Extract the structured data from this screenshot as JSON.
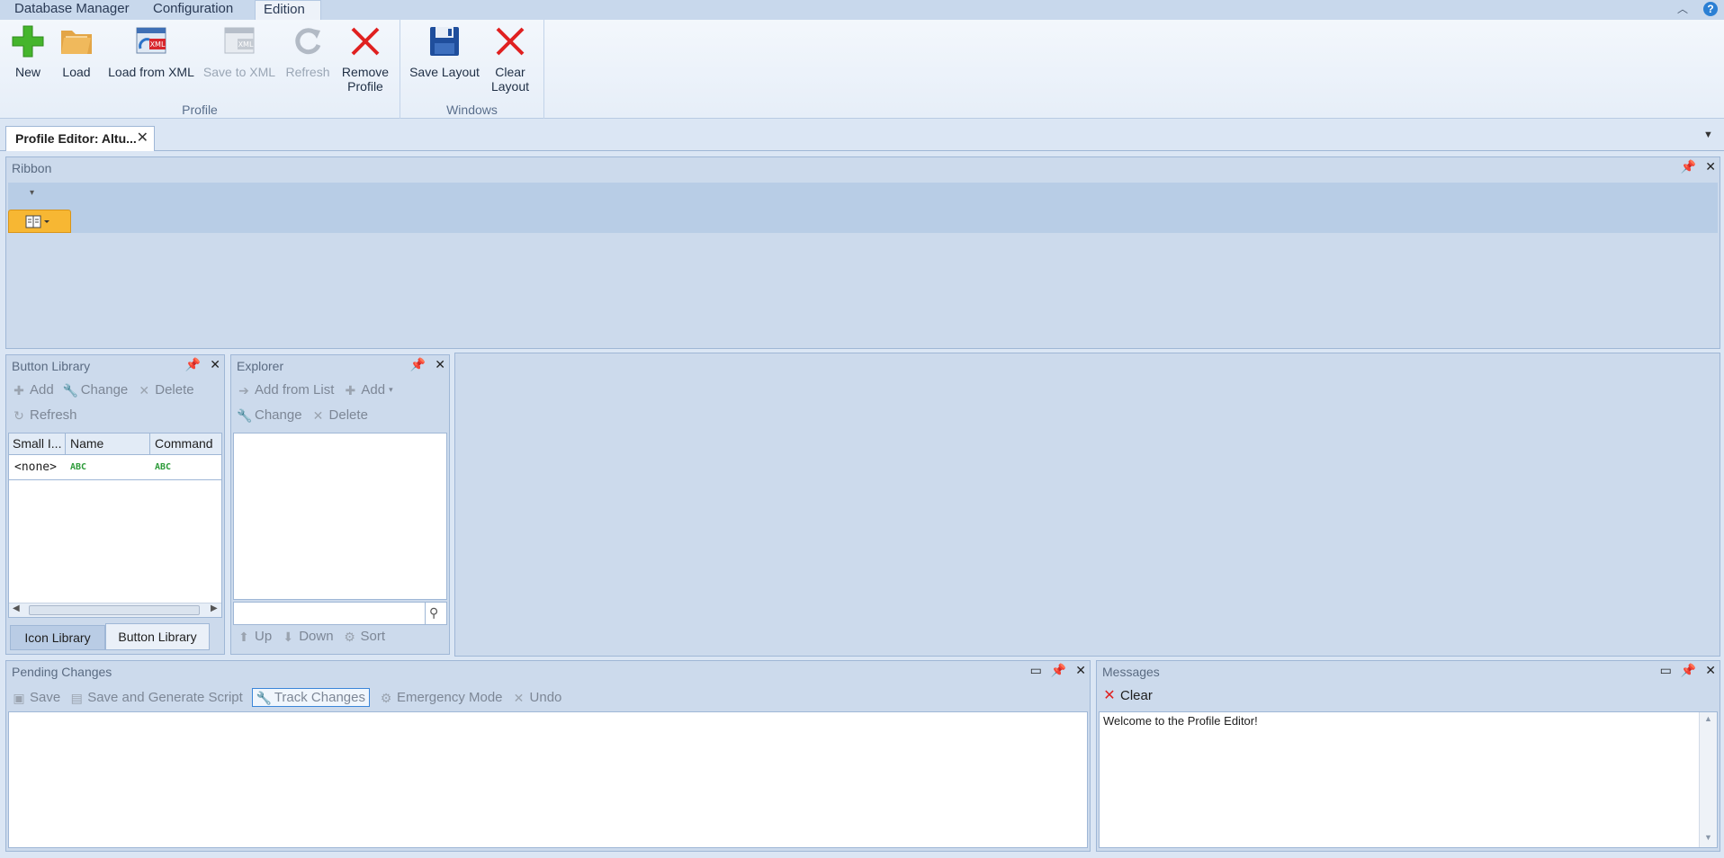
{
  "top_tabs": [
    "Database Manager",
    "Configuration",
    "Edition"
  ],
  "ribbon": {
    "groups": [
      {
        "label": "Profile",
        "buttons": [
          {
            "label": "New",
            "icon": "plus-icon"
          },
          {
            "label": "Load",
            "icon": "folder-icon"
          },
          {
            "label": "Load from XML",
            "icon": "xml-import-icon"
          },
          {
            "label": "Save to XML",
            "icon": "xml-export-icon"
          },
          {
            "label": "Refresh",
            "icon": "refresh-icon"
          },
          {
            "label_line1": "Remove",
            "label_line2": "Profile",
            "icon": "red-x-icon"
          }
        ]
      },
      {
        "label": "Windows",
        "buttons": [
          {
            "label": "Save Layout",
            "icon": "floppy-icon"
          },
          {
            "label_line1": "Clear",
            "label_line2": "Layout",
            "icon": "red-x-icon"
          }
        ]
      }
    ]
  },
  "document_tab": {
    "label": "Profile Editor: Altu...",
    "close": "✕"
  },
  "ribbon_panel": {
    "title": "Ribbon"
  },
  "button_library": {
    "title": "Button Library",
    "toolbar": {
      "add": "Add",
      "change": "Change",
      "delete": "Delete",
      "refresh": "Refresh"
    },
    "columns": [
      "Small I...",
      "Name",
      "Command"
    ],
    "rows": [
      {
        "icon": "<none>"
      }
    ],
    "tabs": [
      "Icon Library",
      "Button Library"
    ]
  },
  "explorer": {
    "title": "Explorer",
    "toolbar": {
      "add_from_list": "Add from List",
      "add": "Add",
      "change": "Change",
      "delete": "Delete"
    },
    "bottom": {
      "up": "Up",
      "down": "Down",
      "sort": "Sort"
    }
  },
  "pending_changes": {
    "title": "Pending Changes",
    "toolbar": {
      "save": "Save",
      "save_generate": "Save and Generate Script",
      "track": "Track Changes",
      "emergency": "Emergency Mode",
      "undo": "Undo"
    }
  },
  "messages": {
    "title": "Messages",
    "clear": "Clear",
    "lines": [
      "Welcome to the Profile Editor!"
    ]
  },
  "colors": {
    "accent_orange": "#f7b733",
    "panel_bg": "#ccdaec",
    "red": "#e02020",
    "green": "#3aa12a"
  }
}
